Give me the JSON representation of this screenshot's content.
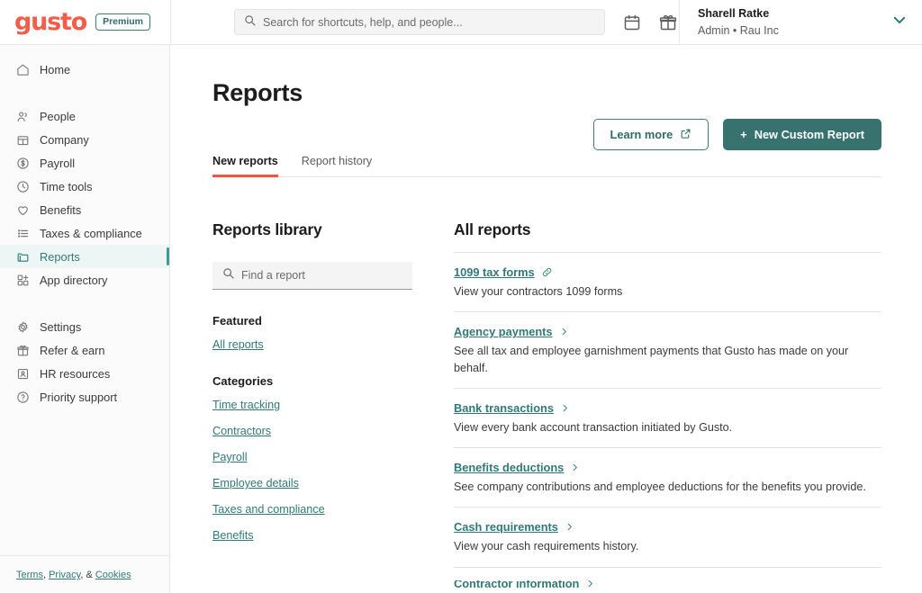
{
  "topbar": {
    "logo_text": "gusto",
    "plan_badge": "Premium",
    "search_placeholder": "Search for shortcuts, help, and people...",
    "calendar_icon": "calendar-icon",
    "gift_icon": "gift-icon",
    "user_name": "Sharell Ratke",
    "user_role": "Admin • Rau Inc",
    "chevron_icon": "chevron-down-icon"
  },
  "sidebar": {
    "primary": [
      {
        "label": "Home",
        "icon": "home-icon"
      }
    ],
    "group_main": [
      {
        "label": "People",
        "icon": "people-icon"
      },
      {
        "label": "Company",
        "icon": "company-icon"
      },
      {
        "label": "Payroll",
        "icon": "payroll-icon"
      },
      {
        "label": "Time tools",
        "icon": "clock-icon"
      },
      {
        "label": "Benefits",
        "icon": "heart-icon"
      },
      {
        "label": "Taxes & compliance",
        "icon": "list-icon"
      },
      {
        "label": "Reports",
        "icon": "folder-icon",
        "active": true
      },
      {
        "label": "App directory",
        "icon": "apps-icon"
      }
    ],
    "group_secondary": [
      {
        "label": "Settings",
        "icon": "gear-icon"
      },
      {
        "label": "Refer & earn",
        "icon": "gift-icon"
      },
      {
        "label": "HR resources",
        "icon": "hr-icon"
      },
      {
        "label": "Priority support",
        "icon": "support-icon"
      }
    ],
    "footer": {
      "terms": "Terms",
      "privacy": "Privacy",
      "cookies": "Cookies",
      "sep1": ", ",
      "sep2": ", & "
    }
  },
  "page": {
    "title": "Reports",
    "learn_more_label": "Learn more",
    "learn_more_icon": "external-link-icon",
    "new_report_label": "New Custom Report",
    "new_report_plus": "+",
    "tabs": [
      {
        "label": "New reports",
        "active": true
      },
      {
        "label": "Report history",
        "active": false
      }
    ]
  },
  "library": {
    "title": "Reports library",
    "search_placeholder": "Find a report",
    "search_icon": "search-icon",
    "featured_heading": "Featured",
    "featured_links": [
      {
        "label": "All reports"
      }
    ],
    "categories_heading": "Categories",
    "categories": [
      {
        "label": "Time tracking"
      },
      {
        "label": "Contractors"
      },
      {
        "label": "Payroll"
      },
      {
        "label": "Employee details"
      },
      {
        "label": "Taxes and compliance"
      },
      {
        "label": "Benefits"
      }
    ]
  },
  "reports": {
    "title": "All reports",
    "items": [
      {
        "name": "1099 tax forms",
        "icon": "link-icon",
        "description": "View your contractors 1099 forms"
      },
      {
        "name": "Agency payments",
        "icon": "chevron-right-icon",
        "description": "See all tax and employee garnishment payments that Gusto has made on your behalf."
      },
      {
        "name": "Bank transactions",
        "icon": "chevron-right-icon",
        "description": "View every bank account transaction initiated by Gusto."
      },
      {
        "name": "Benefits deductions",
        "icon": "chevron-right-icon",
        "description": "See company contributions and employee deductions for the benefits you provide."
      },
      {
        "name": "Cash requirements",
        "icon": "chevron-right-icon",
        "description": "View your cash requirements history."
      },
      {
        "name": "Contractor information",
        "icon": "chevron-right-icon",
        "description": ""
      }
    ]
  },
  "colors": {
    "brand_coral": "#f45d48",
    "teal": "#2f7a78",
    "teal_button": "#38726e",
    "tab_underline": "#f4543c",
    "active_nav_bg": "#eef6f5"
  }
}
